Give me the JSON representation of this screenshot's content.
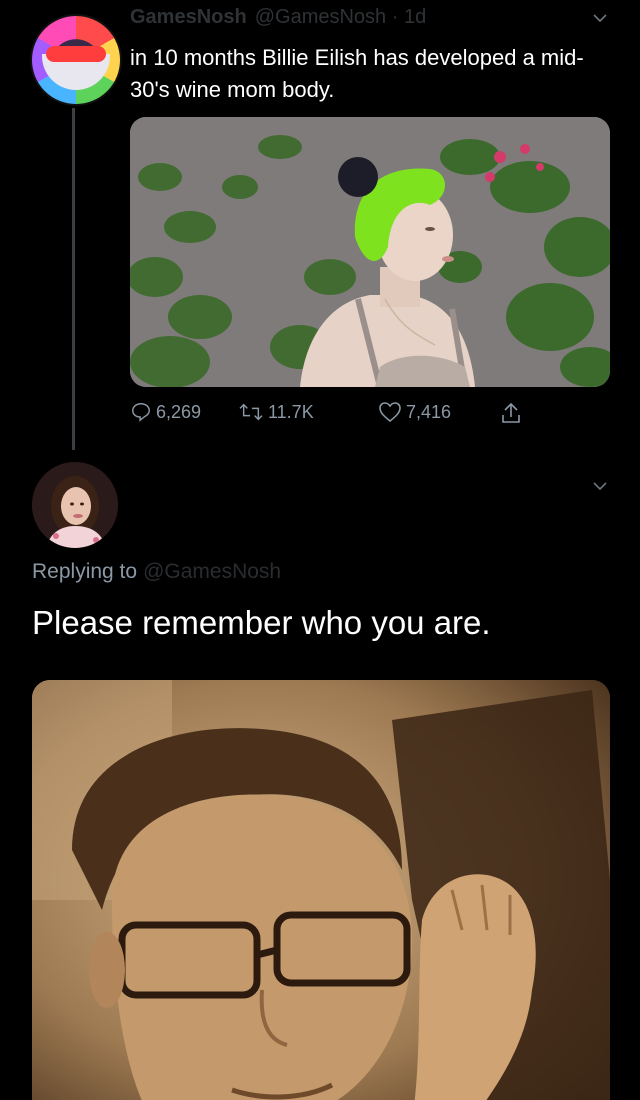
{
  "tweet": {
    "display_name": "GamesNosh",
    "handle": "@GamesNosh · 1d",
    "text": "in 10 months Billie Eilish has developed a mid-30's wine mom body.",
    "stats": {
      "replies": "6,269",
      "retweets": "11.7K",
      "likes": "7,416"
    }
  },
  "reply": {
    "display_name": "",
    "handle": "",
    "replying_label": "Replying to",
    "replying_to": "@GamesNosh",
    "text": "Please remember who you are."
  },
  "colors": {
    "background": "#000000",
    "text": "#ffffff",
    "muted": "#8b98a5",
    "thread_line": "#3a3f44"
  },
  "icons": {
    "reply": "comment-icon",
    "retweet": "retweet-icon",
    "like": "heart-icon",
    "share": "share-icon",
    "menu": "chevron-down-icon"
  }
}
